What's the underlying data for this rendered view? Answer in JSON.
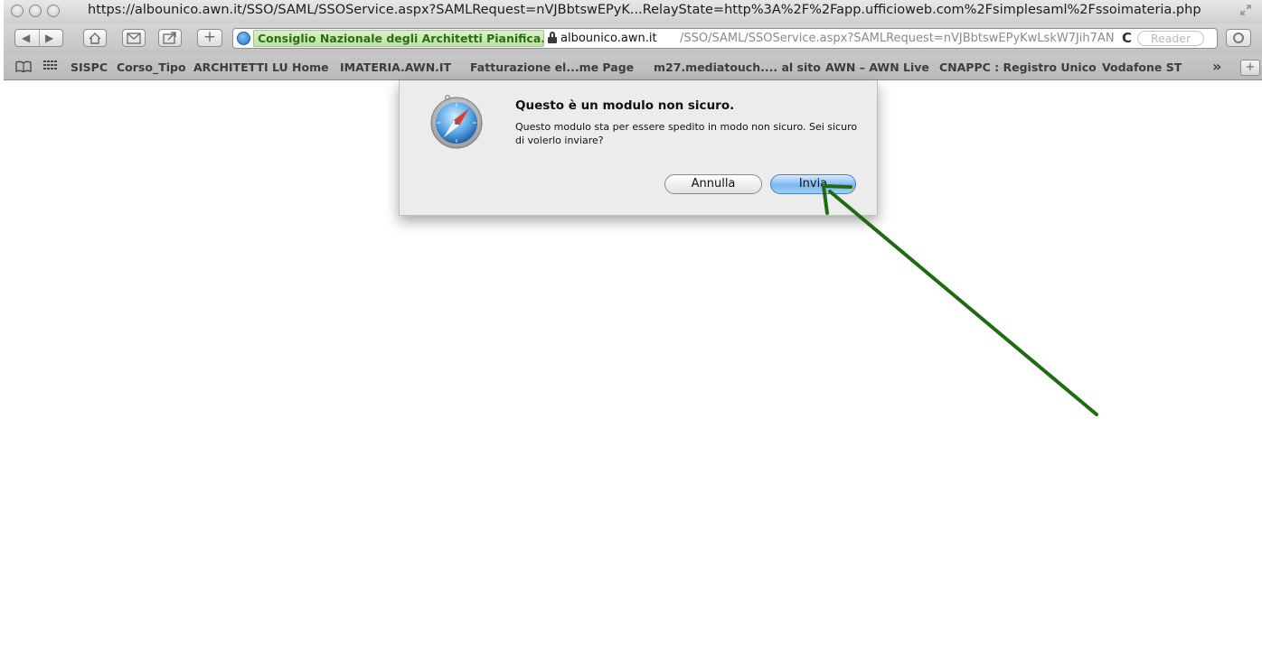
{
  "window": {
    "title": "https://albounico.awn.it/SSO/SAML/SSOService.aspx?SAMLRequest=nVJBbtswEPyK...RelayState=http%3A%2F%2Fapp.ufficioweb.com%2Fsimplesaml%2Fssoimateria.php"
  },
  "toolbar": {
    "ev_name": "Consiglio Nazionale degli Architetti Pianifica...",
    "url_host": "albounico.awn.it",
    "url_path": "/SSO/SAML/SSOService.aspx?SAMLRequest=nVJBbtswEPyKwLskW7Jih7AN",
    "reload_glyph": "C",
    "reader_label": "Reader"
  },
  "bookmarks": {
    "items": [
      "SISPC",
      "Corso_Tipo",
      "ARCHITETTI LU Home",
      "IMATERIA.AWN.IT",
      "Fatturazione el...me Page",
      "m27.mediatouch.... al sito",
      "AWN – AWN Live",
      "CNAPPC : Registro Unico",
      "Vodafone ST"
    ],
    "overflow_glyph": "»",
    "add_glyph": "+"
  },
  "dialog": {
    "title": "Questo è un modulo non sicuro.",
    "message": "Questo modulo sta per essere spedito in modo non sicuro. Sei sicuro di volerlo inviare?",
    "cancel_label": "Annulla",
    "send_label": "Invia"
  },
  "colors": {
    "annotation_arrow": "#1e6b12",
    "ev_badge_text": "#2a6b19",
    "default_button": "#7db7f2"
  }
}
